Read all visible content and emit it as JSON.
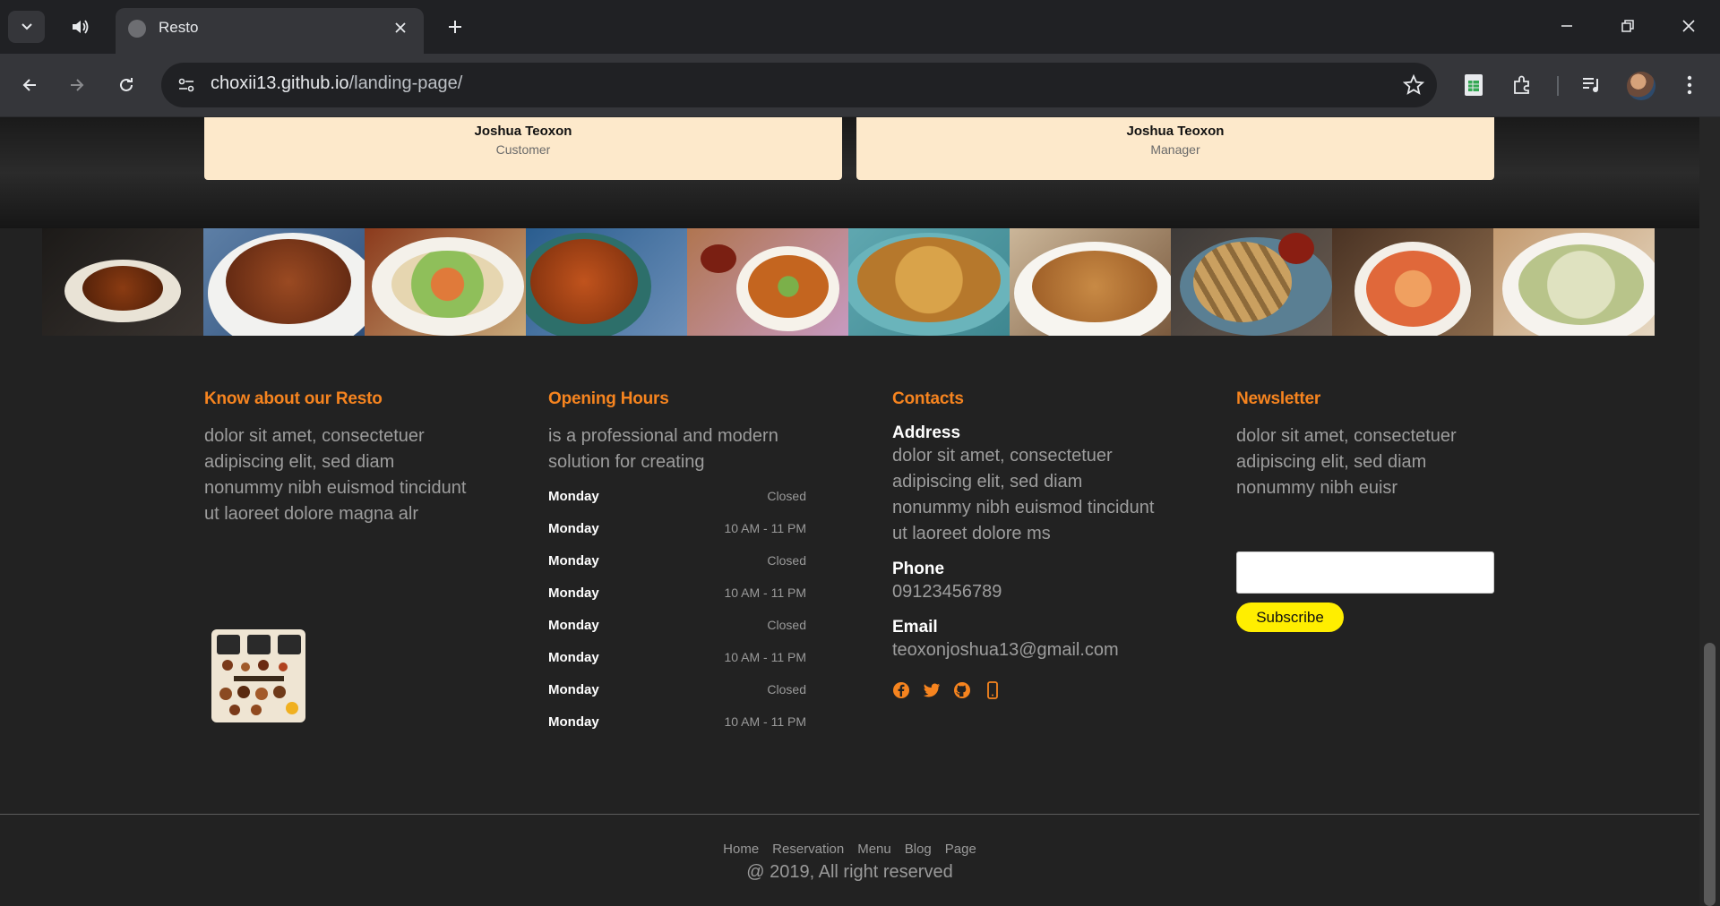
{
  "browser": {
    "tab_title": "Resto",
    "url_host": "choxii13.github.io",
    "url_path": "/landing-page/"
  },
  "testimonials": [
    {
      "name": "Joshua Teoxon",
      "role": "Customer"
    },
    {
      "name": "Joshua Teoxon",
      "role": "Manager"
    }
  ],
  "gallery": {
    "photos": [
      "food-photo-1",
      "food-photo-2",
      "food-photo-3",
      "food-photo-4",
      "food-photo-5",
      "food-photo-6",
      "food-photo-7",
      "food-photo-8",
      "food-photo-9",
      "food-photo-10"
    ]
  },
  "about": {
    "heading": "Know about our Resto",
    "text": "dolor sit amet, consectetuer adipiscing elit, sed diam nonummy nibh euismod tincidunt ut laoreet dolore magna alr"
  },
  "hours": {
    "heading": "Opening Hours",
    "intro": "is a professional and modern solution for creating",
    "rows": [
      {
        "day": "Monday",
        "time": "Closed"
      },
      {
        "day": "Monday",
        "time": "10 AM - 11 PM"
      },
      {
        "day": "Monday",
        "time": "Closed"
      },
      {
        "day": "Monday",
        "time": "10 AM - 11 PM"
      },
      {
        "day": "Monday",
        "time": "Closed"
      },
      {
        "day": "Monday",
        "time": "10 AM - 11 PM"
      },
      {
        "day": "Monday",
        "time": "Closed"
      },
      {
        "day": "Monday",
        "time": "10 AM - 11 PM"
      }
    ]
  },
  "contacts": {
    "heading": "Contacts",
    "address_label": "Address",
    "address": "dolor sit amet, consectetuer adipiscing elit, sed diam nonummy nibh euismod tincidunt ut laoreet dolore ms",
    "phone_label": "Phone",
    "phone": "09123456789",
    "email_label": "Email",
    "email": "teoxonjoshua13@gmail.com",
    "social_icons": [
      "facebook-icon",
      "twitter-icon",
      "github-icon",
      "mobile-icon"
    ]
  },
  "newsletter": {
    "heading": "Newsletter",
    "text": "dolor sit amet, consectetuer adipiscing elit, sed diam nonummy nibh euisr",
    "input_value": "",
    "button": "Subscribe"
  },
  "footer": {
    "links": [
      "Home",
      "Reservation",
      "Menu",
      "Blog",
      "Page"
    ],
    "copyright": "@ 2019, All right reserved"
  },
  "colors": {
    "accent": "#f6841f",
    "subscribe": "#ffee00",
    "card": "#fde9cb",
    "page_bg": "#222222"
  }
}
